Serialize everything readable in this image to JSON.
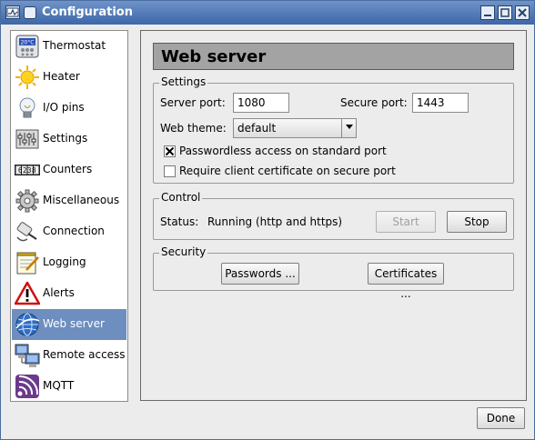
{
  "window": {
    "title": "Configuration"
  },
  "sidebar": {
    "items": [
      {
        "label": "Thermostat",
        "icon": "thermostat-icon"
      },
      {
        "label": "Heater",
        "icon": "sun-icon"
      },
      {
        "label": "I/O pins",
        "icon": "bulb-icon"
      },
      {
        "label": "Settings",
        "icon": "settings-panel-icon"
      },
      {
        "label": "Counters",
        "icon": "counter-icon"
      },
      {
        "label": "Miscellaneous",
        "icon": "gear-icon"
      },
      {
        "label": "Connection",
        "icon": "plug-icon"
      },
      {
        "label": "Logging",
        "icon": "notepad-icon"
      },
      {
        "label": "Alerts",
        "icon": "warning-icon"
      },
      {
        "label": "Web server",
        "icon": "globe-icon"
      },
      {
        "label": "Remote access",
        "icon": "computers-icon"
      },
      {
        "label": "MQTT",
        "icon": "wifi-signal-icon"
      }
    ],
    "selected": "Web server",
    "thermostat_icon_text": "20°C",
    "counter_icon_text": "6238"
  },
  "page": {
    "title": "Web server"
  },
  "settings": {
    "title": "Settings",
    "server_port_label": "Server port:",
    "server_port_value": "1080",
    "secure_port_label": "Secure port:",
    "secure_port_value": "1443",
    "web_theme_label": "Web theme:",
    "web_theme_value": "default",
    "passwordless_label": "Passwordless access on standard port",
    "passwordless_checked": true,
    "client_cert_label": "Require client certificate on secure port",
    "client_cert_checked": false
  },
  "control": {
    "title": "Control",
    "status_label": "Status:",
    "status_value": "Running (http and https)",
    "start_label": "Start",
    "stop_label": "Stop"
  },
  "security": {
    "title": "Security",
    "passwords_label": "Passwords ...",
    "certificates_label": "Certificates ..."
  },
  "footer": {
    "done_label": "Done"
  },
  "colors": {
    "titlebar": "#4f77b5",
    "selection": "#6d8ebf",
    "heading": "#a3a3a3"
  }
}
